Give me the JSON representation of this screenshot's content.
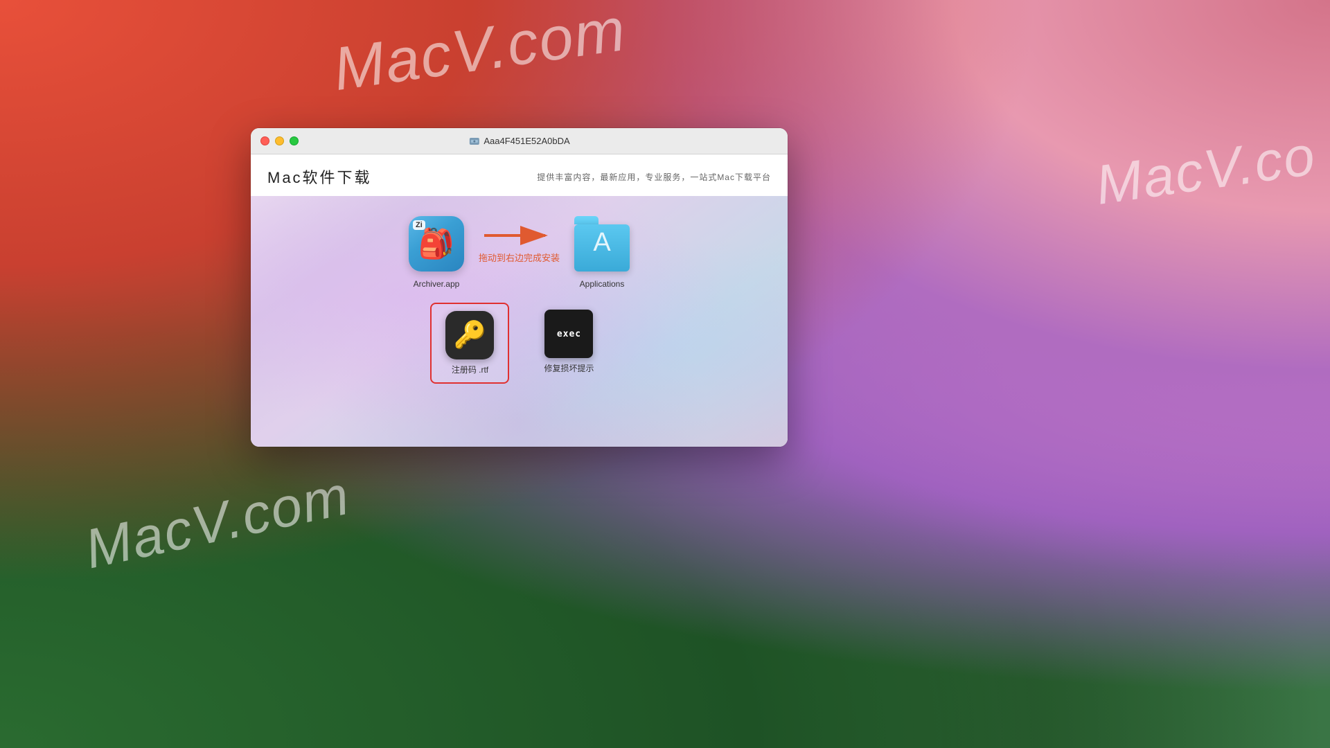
{
  "desktop": {
    "watermarks": [
      "MacV.com",
      "MacV.com",
      "MacV.co"
    ]
  },
  "window": {
    "title": "Aaa4F451E52A0bDA",
    "header": {
      "site_title": "Mac软件下载",
      "site_subtitle": "提供丰富内容，最新应用，专业服务，一站式Mac下载平台"
    },
    "traffic_lights": {
      "close_label": "close",
      "minimize_label": "minimize",
      "maximize_label": "maximize"
    }
  },
  "dmg": {
    "archiver": {
      "label": "Archiver.app",
      "badge": "Zi"
    },
    "arrow": {
      "drag_label": "拖动到右边完成安装"
    },
    "applications": {
      "label": "Applications"
    },
    "reg_file": {
      "label": "注册码 .rtf"
    },
    "repair": {
      "exec_label": "exec",
      "label": "修复损坏提示"
    }
  }
}
